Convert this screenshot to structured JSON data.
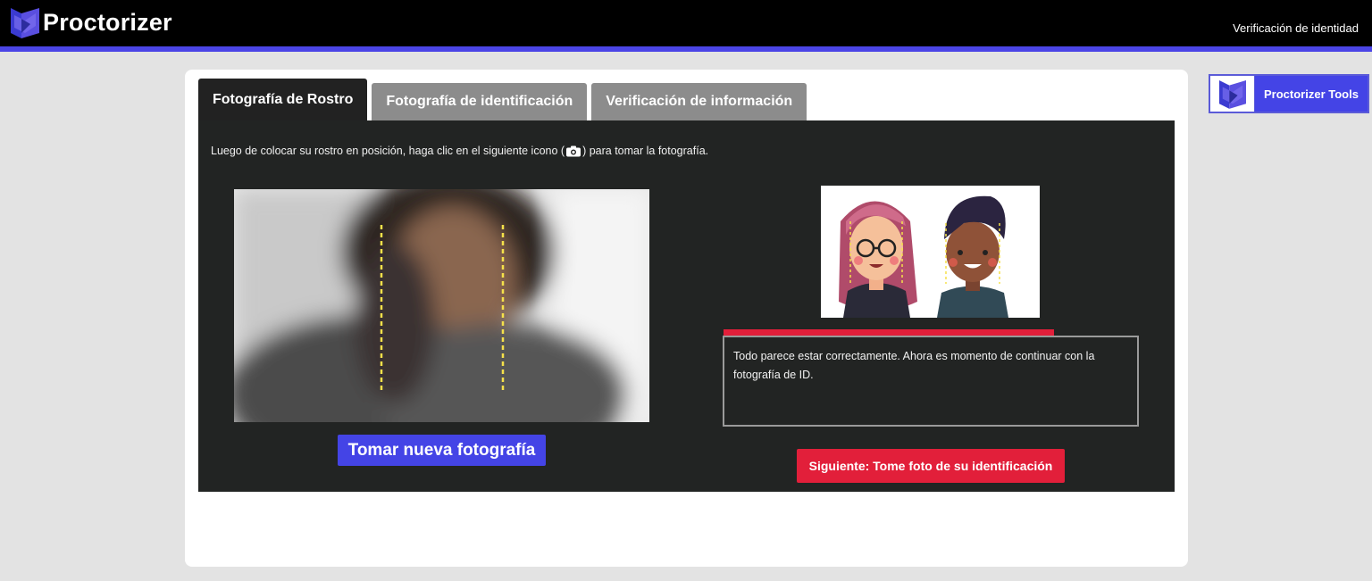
{
  "header": {
    "brand": "Proctorizer",
    "page_heading": "Verificación de identidad"
  },
  "tabs": [
    {
      "label": "Fotografía de Rostro",
      "active": true
    },
    {
      "label": "Fotografía de identificación",
      "active": false
    },
    {
      "label": "Verificación de información",
      "active": false
    }
  ],
  "panel": {
    "instruction_before": "Luego de colocar su rostro en posición, haga clic en el siguiente icono (",
    "instruction_icon": "camera-icon",
    "instruction_after": ") para tomar la fotografía.",
    "retake_button": "Tomar nueva fotografía",
    "status_message": "Todo parece estar correctamente. Ahora es momento de continuar con la fotografía de ID.",
    "next_button": "Siguiente: Tome foto de su identificación"
  },
  "tools": {
    "label": "Proctorizer Tools"
  },
  "colors": {
    "accent": "#4444e6",
    "danger": "#e21f3a",
    "panel": "#222423",
    "guide_lines": "#f5e14a"
  }
}
